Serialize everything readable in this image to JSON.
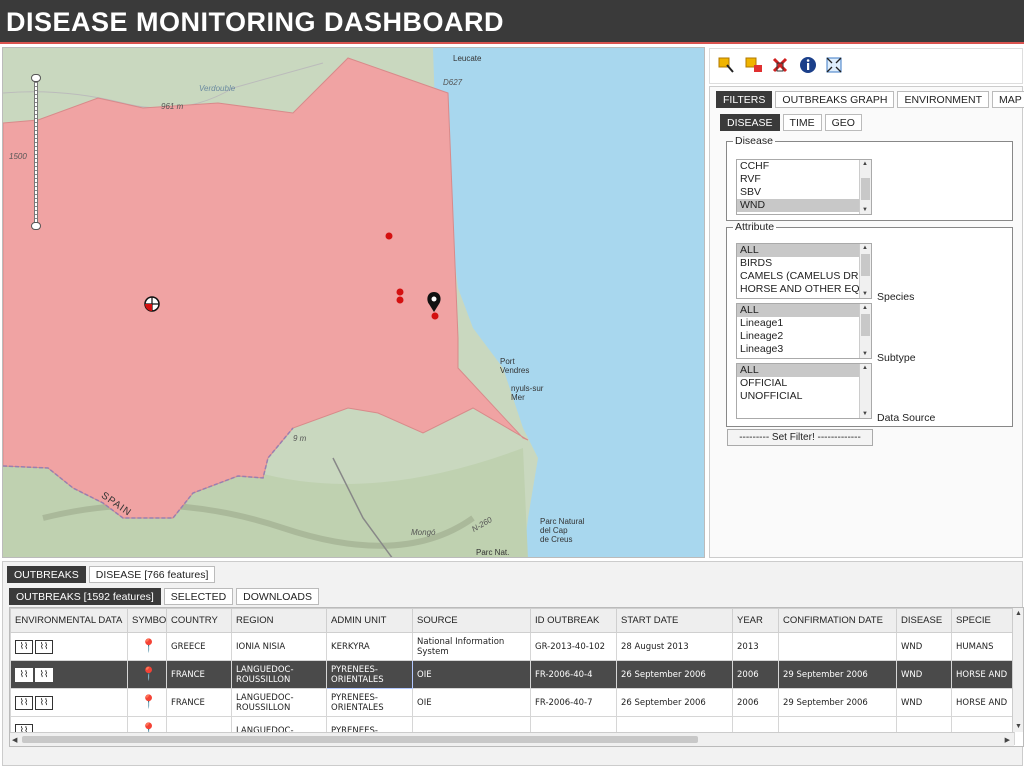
{
  "app": {
    "title": "DISEASE MONITORING DASHBOARD"
  },
  "map": {
    "place_labels": {
      "leucate": "Leucate",
      "port_vendres": "Port\nVendres",
      "banyuls": "nyuls-sur\nMer",
      "spain": "SPAIN",
      "cap_creus": "Parc Natural\ndel Cap\nde Creus",
      "parc_nat": "Parc Nat.",
      "elev_961": "961 m",
      "elev_1500": "1500",
      "verdouble": "Verdouble",
      "road_d627": "D627",
      "road_n260": "N-260",
      "mongo": "Mongó",
      "elev_9m": "9 m"
    },
    "zoom_level_fraction": 0.95
  },
  "toolbar": {
    "tools": [
      {
        "name": "select-tool-icon",
        "glyph": "⬚"
      },
      {
        "name": "clear-selection-icon",
        "glyph": "▣"
      },
      {
        "name": "remove-icon",
        "glyph": "✘"
      },
      {
        "name": "info-icon",
        "glyph": "ℹ"
      },
      {
        "name": "zoom-extent-icon",
        "glyph": "⤧"
      }
    ]
  },
  "panel": {
    "main_tabs": [
      "FILTERS",
      "OUTBREAKS GRAPH",
      "ENVIRONMENT",
      "MAP"
    ],
    "sub_tabs": [
      "DISEASE",
      "TIME",
      "GEO"
    ],
    "disease_legend": "Disease",
    "disease_options": [
      "CCHF",
      "RVF",
      "SBV",
      "WND"
    ],
    "attribute_legend": "Attribute",
    "species_options": [
      "ALL",
      "BIRDS",
      "CAMELS (CAMELUS DR",
      "HORSE AND OTHER EQ"
    ],
    "species_label": "Species",
    "subtype_options": [
      "ALL",
      "Lineage1",
      "Lineage2",
      "Lineage3"
    ],
    "subtype_label": "Subtype",
    "source_options": [
      "ALL",
      "OFFICIAL",
      "UNOFFICIAL"
    ],
    "source_label": "Data Source",
    "set_filter_label": "--------- Set Filter! -------------"
  },
  "bottom": {
    "tabs": [
      "OUTBREAKS",
      "DISEASE [766 features]"
    ],
    "sub_tabs": [
      "OUTBREAKS [1592 features]",
      "SELECTED",
      "DOWNLOADS"
    ],
    "columns": [
      "ENVIRONMENTAL DATA",
      "SYMBOL",
      "COUNTRY",
      "REGION",
      "ADMIN UNIT",
      "SOURCE",
      "ID OUTBREAK",
      "START DATE",
      "YEAR",
      "CONFIRMATION DATE",
      "DISEASE",
      "SPECIE"
    ],
    "rows": [
      {
        "country": "GREECE",
        "region": "IONIA NISIA",
        "admin": "KERKYRA",
        "source": "National Information System",
        "id": "GR-2013-40-102",
        "start": "28 August 2013",
        "year": "2013",
        "confirm": "",
        "disease": "WND",
        "specie": "HUMANS"
      },
      {
        "country": "FRANCE",
        "region": "LANGUEDOC-ROUSSILLON",
        "admin": "PYRENEES-ORIENTALES",
        "source": "OIE",
        "id": "FR-2006-40-4",
        "start": "26 September 2006",
        "year": "2006",
        "confirm": "29 September 2006",
        "disease": "WND",
        "specie": "HORSE AND"
      },
      {
        "country": "FRANCE",
        "region": "LANGUEDOC-ROUSSILLON",
        "admin": "PYRENEES-ORIENTALES",
        "source": "OIE",
        "id": "FR-2006-40-7",
        "start": "26 September 2006",
        "year": "2006",
        "confirm": "29 September 2006",
        "disease": "WND",
        "specie": "HORSE AND"
      },
      {
        "country": "",
        "region": "LANGUEDOC-",
        "admin": "PYRENEES-",
        "source": "",
        "id": "",
        "start": "",
        "year": "",
        "confirm": "",
        "disease": "",
        "specie": ""
      }
    ],
    "selected_row_index": 1
  }
}
